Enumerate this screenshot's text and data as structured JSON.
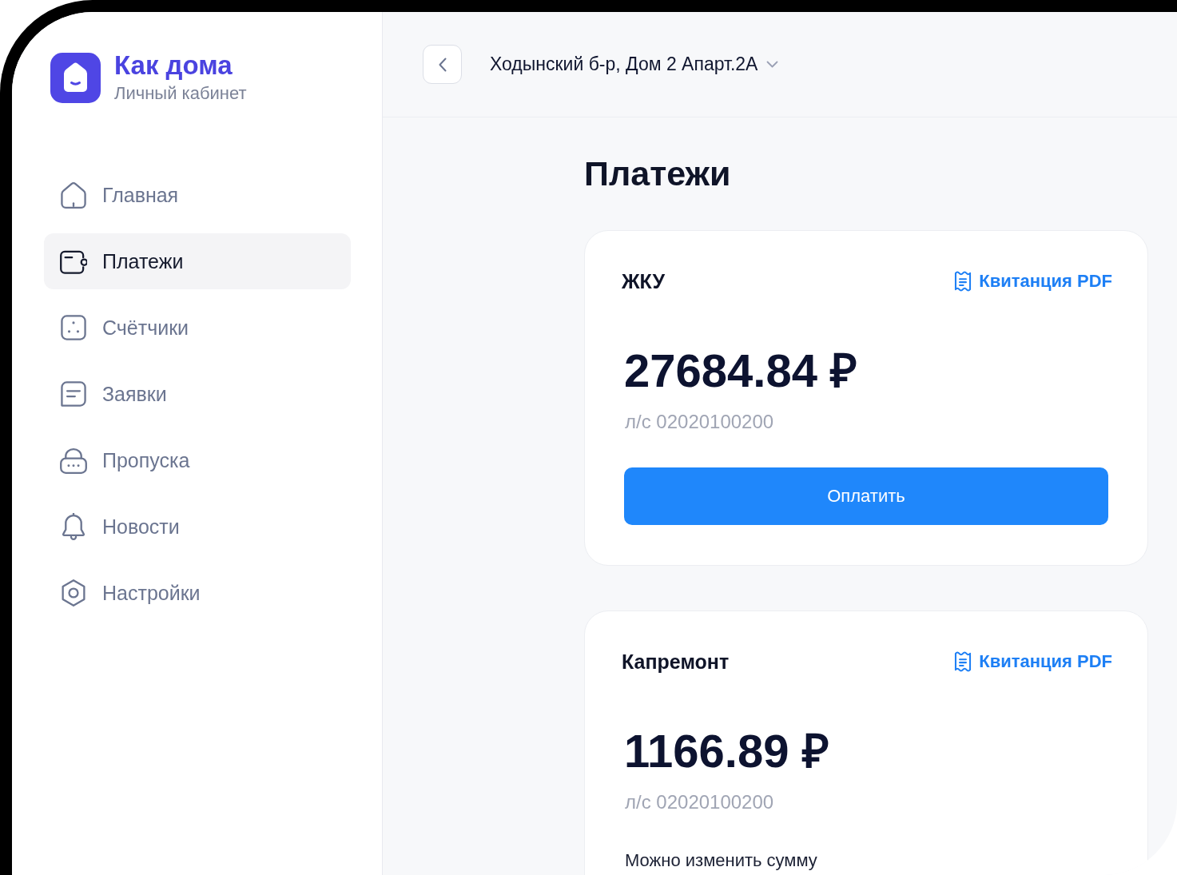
{
  "brand": {
    "name": "Как дома",
    "subtitle": "Личный кабинет"
  },
  "sidebar": {
    "items": [
      {
        "label": "Главная",
        "kind": "home",
        "selected": false
      },
      {
        "label": "Платежи",
        "kind": "wallet",
        "selected": true
      },
      {
        "label": "Счётчики",
        "kind": "meters",
        "selected": false
      },
      {
        "label": "Заявки",
        "kind": "requests",
        "selected": false
      },
      {
        "label": "Пропуска",
        "kind": "passes",
        "selected": false
      },
      {
        "label": "Новости",
        "kind": "news",
        "selected": false
      },
      {
        "label": "Настройки",
        "kind": "settings",
        "selected": false
      }
    ]
  },
  "header": {
    "address": "Ходынский б-р, Дом 2 Апарт.2А"
  },
  "page": {
    "title": "Платежи"
  },
  "payments": [
    {
      "title": "ЖКУ",
      "receipt_link": "Квитанция PDF",
      "amount": "27684.84 ₽",
      "account": "л/с 02020100200",
      "pay_button": "Оплатить"
    },
    {
      "title": "Капремонт",
      "receipt_link": "Квитанция PDF",
      "amount": "1166.89 ₽",
      "account": "л/с 02020100200",
      "note": "Можно изменить сумму"
    }
  ]
}
